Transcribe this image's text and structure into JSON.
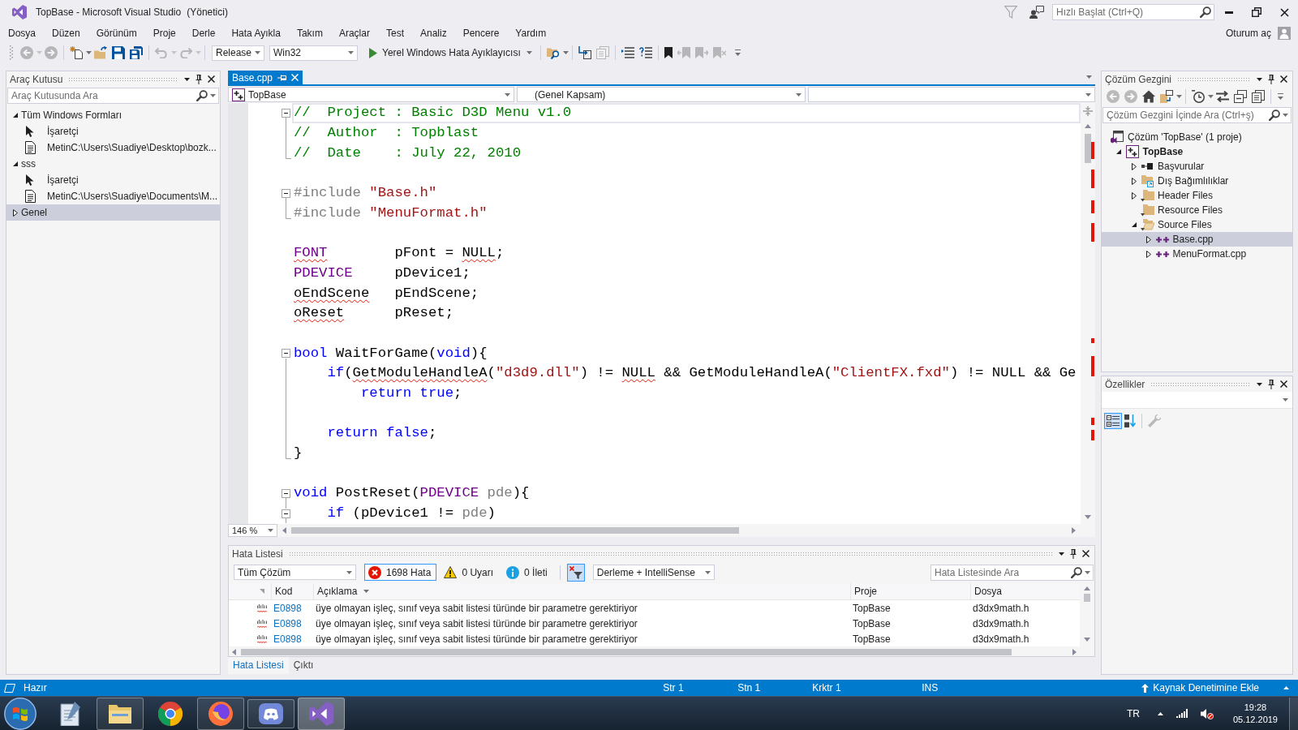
{
  "title_bar": {
    "title": "TopBase - Microsoft Visual Studio",
    "role": "(Yönetici)",
    "quick_launch": {
      "placeholder": "Hızlı Başlat (Ctrl+Q)"
    }
  },
  "menu_bar": {
    "items": [
      "Dosya",
      "Düzen",
      "Görünüm",
      "Proje",
      "Derle",
      "Hata Ayıkla",
      "Takım",
      "Araçlar",
      "Test",
      "Analiz",
      "Pencere",
      "Yardım"
    ],
    "sign_in": "Oturum aç"
  },
  "toolbar": {
    "groups": [
      [
        {
          "kind": "navigate_back",
          "disabled": true
        },
        {
          "kind": "navigate_forward",
          "disabled": true
        }
      ],
      [
        {
          "kind": "new_project",
          "disabled": false
        },
        {
          "kind": "open",
          "disabled": false
        },
        {
          "kind": "save",
          "disabled": false
        },
        {
          "kind": "save_all",
          "disabled": false
        }
      ],
      [
        {
          "kind": "undo",
          "disabled": true
        },
        {
          "kind": "redo",
          "disabled": true
        }
      ],
      [
        {
          "kind": "configuration",
          "value": "Release"
        },
        {
          "kind": "platform",
          "value": "Win32"
        },
        {
          "kind": "start",
          "label": "Yerel Windows Hata Ayıklayıcısı"
        }
      ],
      [
        {
          "kind": "find_in_files",
          "disabled": false
        }
      ],
      [
        {
          "kind": "step_into",
          "disabled": false
        },
        {
          "kind": "pages",
          "disabled": true
        }
      ],
      [
        {
          "kind": "comment",
          "disabled": false
        },
        {
          "kind": "uncomment",
          "disabled": false
        }
      ],
      [
        {
          "kind": "bookmark",
          "disabled": false
        },
        {
          "kind": "bookmark_prev",
          "disabled": true
        },
        {
          "kind": "bookmark_next",
          "disabled": true
        },
        {
          "kind": "bookmark_clear",
          "disabled": true
        }
      ]
    ]
  },
  "toolbox": {
    "title": "Araç Kutusu",
    "search": {
      "placeholder": "Araç Kutusunda Ara"
    },
    "groups": [
      {
        "label": "Tüm Windows Formları",
        "expanded": true,
        "selected": false,
        "items": [
          {
            "kind": "pointer",
            "label": "İşaretçi",
            "selected": false
          },
          {
            "kind": "text",
            "label": "MetinC:\\Users\\Suadiye\\Desktop\\bozk...",
            "selected": false
          }
        ]
      },
      {
        "label": "sss",
        "expanded": true,
        "selected": false,
        "items": [
          {
            "kind": "pointer",
            "label": "İşaretçi",
            "selected": false
          },
          {
            "kind": "text",
            "label": "MetinC:\\Users\\Suadiye\\Documents\\M...",
            "selected": false
          }
        ]
      },
      {
        "label": "Genel",
        "expanded": false,
        "selected": true
      }
    ]
  },
  "editor": {
    "tabs": [
      {
        "label": "Base.cpp",
        "selected": true
      }
    ],
    "navigation": {
      "project": "TopBase",
      "scope": "(Genel Kapsam)"
    },
    "blocks": [
      [
        {
          "expanded": true,
          "current": true,
          "tokens": [
            {
              "kind": "comment",
              "text": "//  Project : Basic D3D Menu v1.0",
              "squiggle": false
            }
          ],
          "children": [
            [
              {
                "current": false,
                "tokens": [
                  {
                    "kind": "comment",
                    "text": "//  Author  : Topblast",
                    "squiggle": false
                  }
                ]
              },
              {
                "current": false,
                "tokens": [
                  {
                    "kind": "comment",
                    "text": "//  Date    : July 22, 2010",
                    "squiggle": false
                  }
                ]
              }
            ]
          ]
        }
      ],
      [
        {
          "expanded": true,
          "current": false,
          "tokens": [
            {
              "kind": "preprocessor",
              "text": "#include ",
              "squiggle": false
            },
            {
              "kind": "string",
              "text": "\"Base.h\"",
              "squiggle": false
            }
          ],
          "children": [
            [
              {
                "current": false,
                "tokens": [
                  {
                    "kind": "preprocessor",
                    "text": "#include ",
                    "squiggle": false
                  },
                  {
                    "kind": "string",
                    "text": "\"MenuFormat.h\"",
                    "squiggle": false
                  }
                ]
              }
            ]
          ]
        }
      ],
      [
        {
          "current": false,
          "tokens": [
            {
              "kind": "type",
              "text": "FONT",
              "squiggle": true
            },
            {
              "kind": "plain",
              "text": "        pFont = ",
              "squiggle": false
            },
            {
              "kind": "plain",
              "text": "NULL",
              "squiggle": true
            },
            {
              "kind": "plain",
              "text": ";",
              "squiggle": false
            }
          ]
        },
        {
          "current": false,
          "tokens": [
            {
              "kind": "type",
              "text": "PDEVICE",
              "squiggle": false
            },
            {
              "kind": "plain",
              "text": "     pDevice1;",
              "squiggle": false
            }
          ]
        },
        {
          "current": false,
          "tokens": [
            {
              "kind": "plain",
              "text": "oEndScene",
              "squiggle": true
            },
            {
              "kind": "plain",
              "text": "   pEndScene;",
              "squiggle": false
            }
          ]
        },
        {
          "current": false,
          "tokens": [
            {
              "kind": "plain",
              "text": "oReset",
              "squiggle": true
            },
            {
              "kind": "plain",
              "text": "      pReset;",
              "squiggle": false
            }
          ]
        }
      ],
      [
        {
          "expanded": true,
          "current": false,
          "tokens": [
            {
              "kind": "keyword",
              "text": "bool",
              "squiggle": false
            },
            {
              "kind": "plain",
              "text": " WaitForGame(",
              "squiggle": false
            },
            {
              "kind": "keyword",
              "text": "void",
              "squiggle": false
            },
            {
              "kind": "plain",
              "text": "){",
              "squiggle": false
            }
          ],
          "children": [
            [
              {
                "current": false,
                "tokens": [
                  {
                    "kind": "keyword",
                    "text": "    if",
                    "squiggle": false
                  },
                  {
                    "kind": "plain",
                    "text": "(",
                    "squiggle": false
                  },
                  {
                    "kind": "plain",
                    "text": "GetModuleHandleA",
                    "squiggle": true
                  },
                  {
                    "kind": "plain",
                    "text": "(",
                    "squiggle": false
                  },
                  {
                    "kind": "string",
                    "text": "\"d3d9.dll\"",
                    "squiggle": false
                  },
                  {
                    "kind": "plain",
                    "text": ") != ",
                    "squiggle": false
                  },
                  {
                    "kind": "plain",
                    "text": "NULL",
                    "squiggle": true
                  },
                  {
                    "kind": "plain",
                    "text": " && GetModuleHandleA(",
                    "squiggle": false
                  },
                  {
                    "kind": "string",
                    "text": "\"ClientFX.fxd\"",
                    "squiggle": false
                  },
                  {
                    "kind": "plain",
                    "text": ") != NULL && Ge",
                    "squiggle": false
                  }
                ]
              },
              {
                "current": false,
                "tokens": [
                  {
                    "kind": "keyword",
                    "text": "        return true",
                    "squiggle": false
                  },
                  {
                    "kind": "plain",
                    "text": ";",
                    "squiggle": false
                  }
                ]
              }
            ],
            [
              {
                "current": false,
                "tokens": [
                  {
                    "kind": "keyword",
                    "text": "    return false",
                    "squiggle": false
                  },
                  {
                    "kind": "plain",
                    "text": ";",
                    "squiggle": false
                  }
                ]
              },
              {
                "current": false,
                "tokens": [
                  {
                    "kind": "plain",
                    "text": "}",
                    "squiggle": false
                  }
                ]
              }
            ]
          ]
        }
      ],
      [
        {
          "expanded": true,
          "current": false,
          "tokens": [
            {
              "kind": "keyword",
              "text": "void",
              "squiggle": false
            },
            {
              "kind": "plain",
              "text": " PostReset(",
              "squiggle": false
            },
            {
              "kind": "type",
              "text": "PDEVICE",
              "squiggle": false
            },
            {
              "kind": "parameter",
              "text": " pde",
              "squiggle": false
            },
            {
              "kind": "plain",
              "text": "){",
              "squiggle": false
            }
          ],
          "children": [
            [
              {
                "expanded": true,
                "current": false,
                "tokens": [
                  {
                    "kind": "keyword",
                    "text": "    if",
                    "squiggle": false
                  },
                  {
                    "kind": "plain",
                    "text": " (pDevice1 != ",
                    "squiggle": false
                  },
                  {
                    "kind": "parameter",
                    "text": "pde",
                    "squiggle": false
                  },
                  {
                    "kind": "plain",
                    "text": ")",
                    "squiggle": false
                  }
                ]
              }
            ]
          ]
        }
      ]
    ],
    "zoom": "146 %"
  },
  "error_list": {
    "title": "Hata Listesi",
    "scope": "Tüm Çözüm",
    "filters": [
      {
        "kind": "error",
        "label": "1698 Hata",
        "selected": true
      },
      {
        "kind": "warning",
        "label": "0 Uyarı",
        "selected": false
      },
      {
        "kind": "info",
        "label": "0 İleti",
        "selected": false
      }
    ],
    "filter_button": {
      "selected": true
    },
    "source": "Derleme + IntelliSense",
    "search": {
      "placeholder": "Hata Listesinde Ara"
    },
    "columns": [
      {
        "label": "Kod",
        "sorted": false
      },
      {
        "label": "Açıklama",
        "sorted": true
      },
      {
        "label": "Proje",
        "sorted": false
      },
      {
        "label": "Dosya",
        "sorted": false
      }
    ],
    "rows": [
      {
        "code": "E0898",
        "description": "üye olmayan işleç, sınıf veya sabit listesi türünde bir parametre gerektiriyor",
        "project": "TopBase",
        "file": "d3dx9math.h",
        "selected": false
      },
      {
        "code": "E0898",
        "description": "üye olmayan işleç, sınıf veya sabit listesi türünde bir parametre gerektiriyor",
        "project": "TopBase",
        "file": "d3dx9math.h",
        "selected": false
      },
      {
        "code": "E0898",
        "description": "üye olmayan işleç, sınıf veya sabit listesi türünde bir parametre gerektiriyor",
        "project": "TopBase",
        "file": "d3dx9math.h",
        "selected": false
      }
    ]
  },
  "bottom_tabs": [
    {
      "label": "Hata Listesi",
      "selected": true
    },
    {
      "label": "Çıktı",
      "selected": false
    }
  ],
  "solution_explorer": {
    "title": "Çözüm Gezgini",
    "toolbar": {
      "groups": [
        [
          {
            "kind": "back",
            "disabled": true
          },
          {
            "kind": "forward",
            "disabled": true
          },
          {
            "kind": "home",
            "disabled": false
          },
          {
            "kind": "switch_views",
            "disabled": false
          }
        ],
        [
          {
            "kind": "pending_changes",
            "disabled": false
          },
          {
            "kind": "sync",
            "disabled": false
          },
          {
            "kind": "collapse_all",
            "disabled": false
          },
          {
            "kind": "show_pages",
            "disabled": false
          }
        ]
      ]
    },
    "search": {
      "placeholder": "Çözüm Gezgini İçinde Ara (Ctrl+ş)"
    },
    "tree": [
      {
        "kind": "solution",
        "label": "Çözüm 'TopBase' (1 proje)",
        "selected": false,
        "children": [
          {
            "kind": "project",
            "label": "TopBase",
            "expanded": true,
            "selected": false,
            "children": [
              {
                "kind": "references",
                "label": "Başvurular",
                "expanded": false,
                "selected": false
              },
              {
                "kind": "external",
                "label": "Dış Bağımlılıklar",
                "expanded": false,
                "selected": false
              },
              {
                "kind": "filter",
                "label": "Header Files",
                "expanded": false,
                "selected": false
              },
              {
                "kind": "filter",
                "label": "Resource Files",
                "selected": false
              },
              {
                "kind": "filter",
                "label": "Source Files",
                "expanded": true,
                "selected": false,
                "children": [
                  {
                    "kind": "file",
                    "label": "Base.cpp",
                    "expanded": false,
                    "selected": true
                  },
                  {
                    "kind": "file",
                    "label": "MenuFormat.cpp",
                    "expanded": false,
                    "selected": false
                  }
                ]
              }
            ]
          }
        ]
      }
    ]
  },
  "properties": {
    "title": "Özellikler",
    "toolbar": {
      "groups": [
        [
          {
            "kind": "categorized",
            "selected": true,
            "disabled": false
          },
          {
            "kind": "alphabetical",
            "selected": false,
            "disabled": false
          }
        ],
        [
          {
            "kind": "property_pages",
            "selected": false,
            "disabled": true
          }
        ]
      ]
    }
  },
  "status_bar": {
    "message": "Hazır",
    "line": "Str 1",
    "column": "Stn 1",
    "character": "Krktr 1",
    "mode": "INS",
    "source_control": "Kaynak Denetimine Ekle"
  },
  "taskbar": {
    "apps": [
      {
        "kind": "notepad",
        "running": false,
        "selected": false
      },
      {
        "kind": "explorer",
        "running": true,
        "selected": false
      },
      {
        "kind": "browser",
        "running": false,
        "selected": false
      },
      {
        "kind": "globe",
        "running": true,
        "selected": false
      },
      {
        "kind": "chat",
        "running": true,
        "selected": false
      },
      {
        "kind": "studio",
        "running": true,
        "selected": true
      }
    ],
    "language": "TR",
    "time": "19:28",
    "date": "05.12.2019"
  }
}
